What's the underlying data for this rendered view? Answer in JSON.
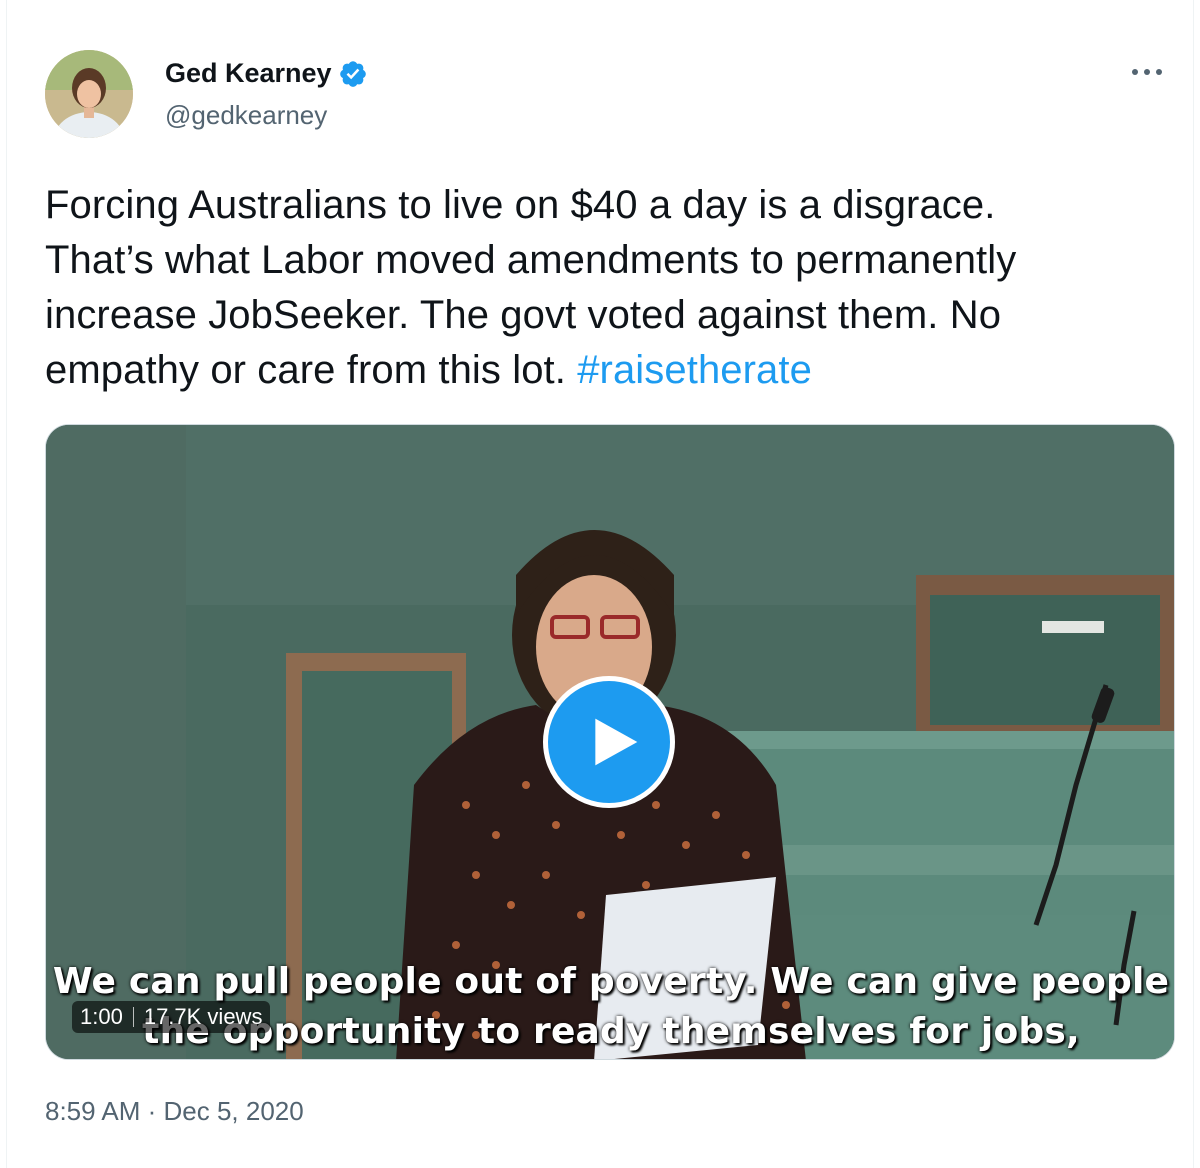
{
  "author": {
    "display_name": "Ged Kearney",
    "handle": "@gedkearney",
    "verified_icon": "verified-badge-icon"
  },
  "menu": {
    "more_icon": "more-horizontal-icon"
  },
  "tweet": {
    "lines": [
      "Forcing Australians to live on $40 a day is a disgrace.",
      "That’s what Labor moved amendments to permanently",
      "increase JobSeeker. The govt voted against them. No",
      "empathy or care from this lot. "
    ],
    "hashtag": "#raisetherate"
  },
  "video": {
    "caption_line_1": "We can pull people out of poverty. We can give people",
    "caption_line_2": "the opportunity to ready themselves for jobs,",
    "duration": "1:00",
    "views": "17.7K views"
  },
  "meta": {
    "time": "8:59 AM",
    "separator": " · ",
    "date": "Dec 5, 2020"
  },
  "colors": {
    "accent": "#1d9bf0",
    "text": "#0f1419",
    "secondary": "#536471"
  }
}
